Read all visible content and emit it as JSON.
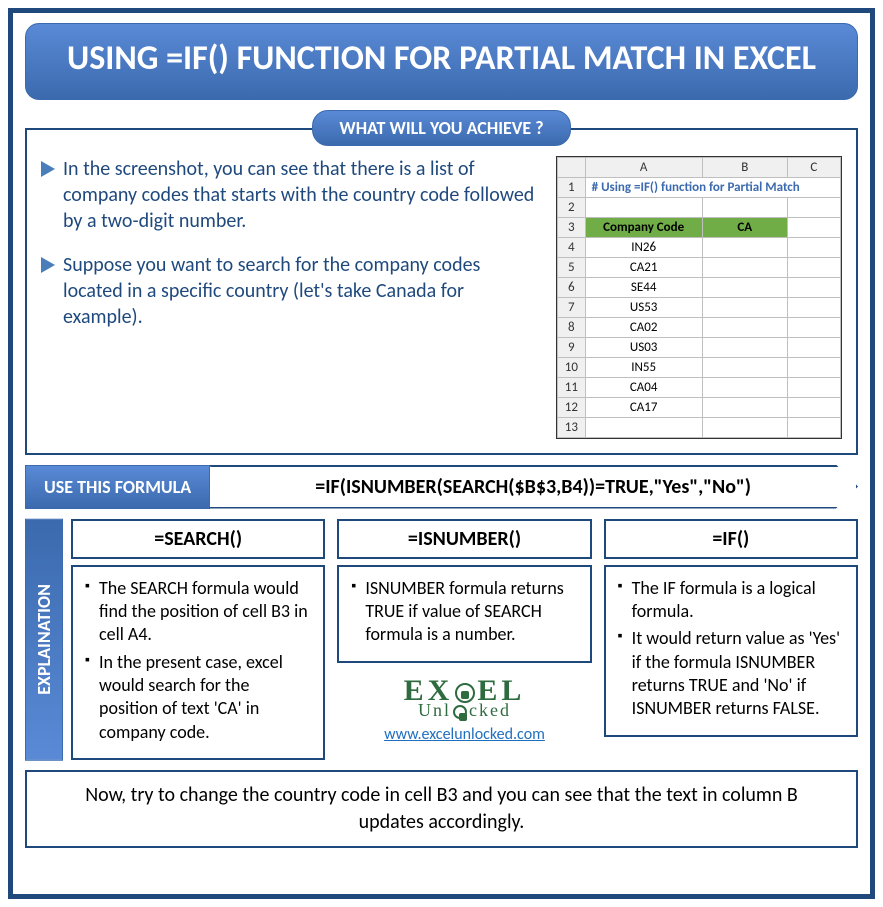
{
  "title": "USING =IF() FUNCTION FOR PARTIAL MATCH IN EXCEL",
  "subhead": "WHAT WILL YOU ACHIEVE ?",
  "bullets": {
    "b1": "In the screenshot, you can see that there is a list of company codes that starts with the country code followed by a two-digit number.",
    "b2": "Suppose you want to search for the company codes located in a specific country (let's take Canada for example)."
  },
  "excel": {
    "cols": [
      "A",
      "B",
      "C"
    ],
    "title_row": "# Using =IF() function for Partial Match",
    "header_a": "Company Code",
    "header_b": "CA",
    "rows": [
      "IN26",
      "CA21",
      "SE44",
      "US53",
      "CA02",
      "US03",
      "IN55",
      "CA04",
      "CA17"
    ]
  },
  "formula_label": "USE THIS FORMULA",
  "formula_text": "=IF(ISNUMBER(SEARCH($B$3,B4))=TRUE,\"Yes\",\"No\")",
  "explain_label": "EXPLAINATION",
  "explain": {
    "search": {
      "head": "=SEARCH()",
      "li1": "The SEARCH formula would find the position of cell B3 in cell A4.",
      "li2": "In the present case, excel would search for the position of text 'CA' in company code."
    },
    "isnumber": {
      "head": "=ISNUMBER()",
      "li1": "ISNUMBER formula returns TRUE if value of SEARCH formula is a number."
    },
    "if": {
      "head": "=IF()",
      "li1": "The IF formula is a logical formula.",
      "li2": "It would return value as 'Yes' if the formula ISNUMBER returns TRUE and 'No' if ISNUMBER returns FALSE."
    }
  },
  "logo": {
    "line1": "EX   EL",
    "line2": "Unl  cked",
    "url": "www.excelunlocked.com"
  },
  "footer": "Now, try to change the country code in cell B3 and you can see that the text in column B updates accordingly."
}
